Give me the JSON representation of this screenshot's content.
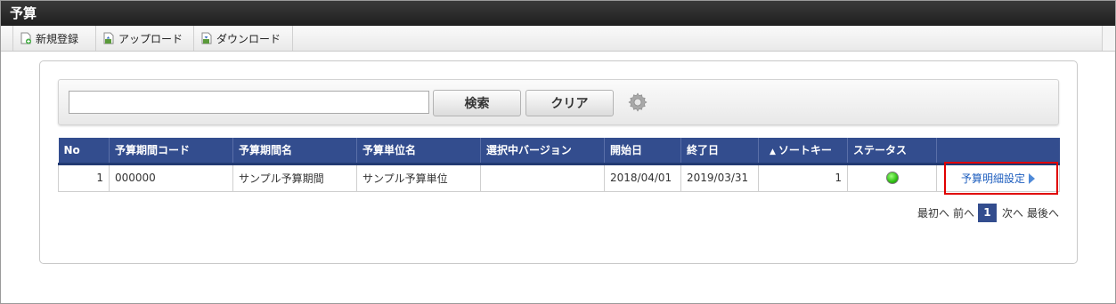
{
  "window": {
    "title": "予算"
  },
  "toolbar": {
    "new_label": "新規登録",
    "upload_label": "アップロード",
    "download_label": "ダウンロード"
  },
  "search": {
    "value": "",
    "placeholder": "",
    "search_label": "検索",
    "clear_label": "クリア"
  },
  "table": {
    "headers": {
      "no": "No",
      "period_code": "予算期間コード",
      "period_name": "予算期間名",
      "unit_name": "予算単位名",
      "version": "選択中バージョン",
      "start": "開始日",
      "end": "終了日",
      "sort_key": "ソートキー",
      "sort_indicator": "▲",
      "status": "ステータス",
      "action": ""
    },
    "rows": [
      {
        "no": "1",
        "period_code": "000000",
        "period_name": "サンプル予算期間",
        "unit_name": "サンプル予算単位",
        "version": "",
        "start": "2018/04/01",
        "end": "2019/03/31",
        "sort_key": "1",
        "status_color": "#2fbf13",
        "action_label": "予算明細設定"
      }
    ]
  },
  "pager": {
    "first": "最初へ",
    "prev": "前へ",
    "current": "1",
    "next": "次へ",
    "last": "最後へ"
  },
  "colors": {
    "header_bg": "#334d8e",
    "link": "#1f5fbf",
    "highlight": "#e00000"
  }
}
